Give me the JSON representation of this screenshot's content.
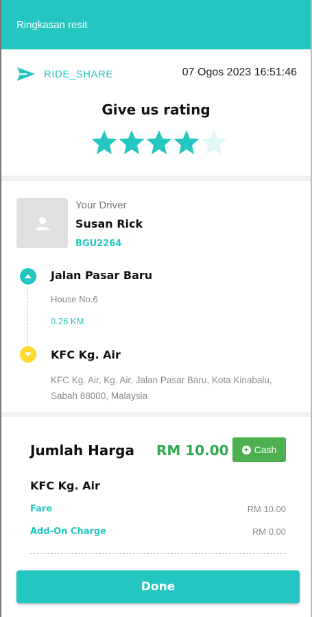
{
  "appbar": {
    "title": "Ringkasan resit"
  },
  "trip": {
    "service": "RIDE_SHARE",
    "datetime": "07 Ogos 2023 16:51:46"
  },
  "rating": {
    "title": "Give us rating",
    "value": 4,
    "max": 5
  },
  "driver": {
    "caption": "Your Driver",
    "name": "Susan Rick",
    "plate": "BGU2264"
  },
  "route": {
    "pickup": {
      "name": "Jalan Pasar Baru",
      "detail": "House No.6",
      "distance": "0.26 KM"
    },
    "dropoff": {
      "name": "KFC Kg. Air",
      "address": "KFC Kg. Air, Kg. Air, Jalan Pasar Baru, Kota Kinabalu, Sabah 88000, Malaysia"
    }
  },
  "payment": {
    "total_label": "Jumlah Harga",
    "total_amount": "RM 10.00",
    "method": "Cash",
    "destination": "KFC Kg. Air",
    "fare_label": "Fare",
    "fare_value": "RM 10.00",
    "addon_label": "Add-On Charge",
    "addon_value": "RM 0.00"
  },
  "actions": {
    "done_label": "Done"
  },
  "colors": {
    "accent": "#23c6c0",
    "price_green": "#2eaa4f",
    "cash_green": "#4caf50",
    "dropoff_yellow": "#ffd92e",
    "star_empty": "#dff7f6"
  },
  "icons": {
    "service": "send-icon",
    "avatar": "person-icon",
    "pickup": "chevron-up-icon",
    "dropoff": "chevron-down-icon",
    "cash": "plus-circle-icon",
    "star": "star-icon"
  }
}
